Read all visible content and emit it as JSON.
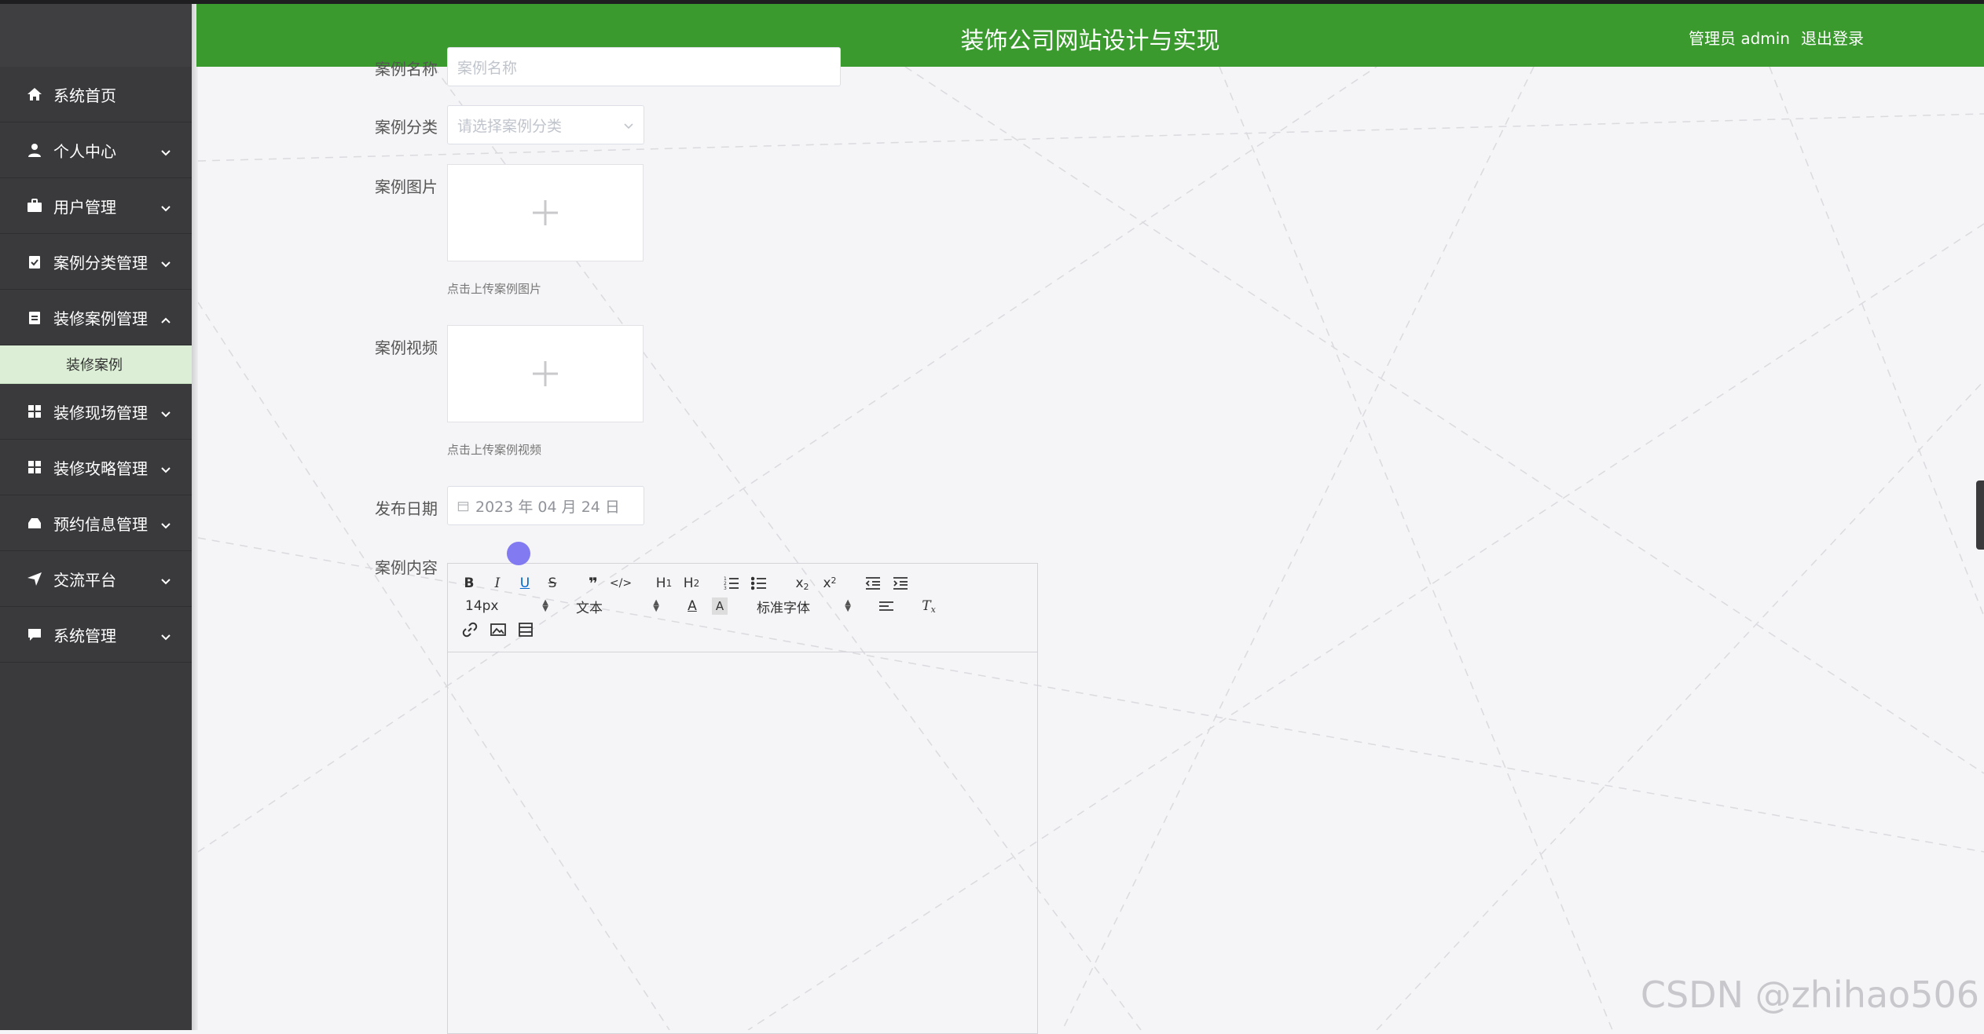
{
  "header": {
    "title": "装饰公司网站设计与实现",
    "user": "管理员 admin",
    "logout": "退出登录"
  },
  "sidebar": {
    "items": [
      {
        "label": "系统首页"
      },
      {
        "label": "个人中心"
      },
      {
        "label": "用户管理"
      },
      {
        "label": "案例分类管理"
      },
      {
        "label": "装修案例管理"
      },
      {
        "label": "装修现场管理"
      },
      {
        "label": "装修攻略管理"
      },
      {
        "label": "预约信息管理"
      },
      {
        "label": "交流平台"
      },
      {
        "label": "系统管理"
      }
    ],
    "submenu": {
      "label": "装修案例"
    }
  },
  "form": {
    "name": {
      "label": "案例名称",
      "placeholder": "案例名称"
    },
    "category": {
      "label": "案例分类",
      "placeholder": "请选择案例分类"
    },
    "image": {
      "label": "案例图片",
      "hint": "点击上传案例图片"
    },
    "video": {
      "label": "案例视频",
      "hint": "点击上传案例视频"
    },
    "date": {
      "label": "发布日期",
      "value": "2023 年 04 月 24 日"
    },
    "content": {
      "label": "案例内容"
    }
  },
  "editor": {
    "font_size": "14px",
    "block_type": "文本",
    "font_family": "标准字体"
  },
  "watermark": "CSDN @zhihao506"
}
